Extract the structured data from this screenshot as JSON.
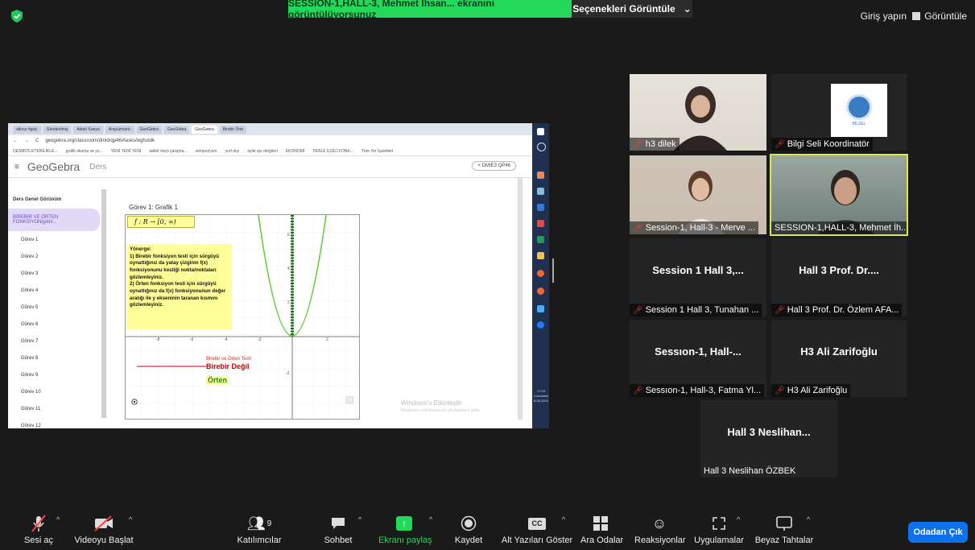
{
  "top": {
    "share_banner": "SESSION-1,HALL-3, Mehmet İhsan... ekranını görüntülüyorsunuz",
    "view_options": "Seçenekleri Görüntüle",
    "sign_in": "Giriş yapın",
    "view": "Görüntüle"
  },
  "shared_screen": {
    "tabs": [
      "altınız #golc",
      "Gönderilmiş",
      "Aktarl Kanya",
      "Arayüzmaric",
      "GeoGebra",
      "GeoGebra",
      "GeoGebra",
      "Birebir Örte"
    ],
    "address": "geogebra.org/classroom/dmid/qp46#tasks/wghutdk",
    "bookmarks": [
      "DESMOS ETKİNLİKLE...",
      "grafik okuma ve yo...",
      "YENİ YENİ YENİ",
      "tablet öncü çalışma...",
      "sempozyum",
      "yurt dışı",
      "aylık ayı dergileri",
      "EKONOMİ",
      "FENLE İLGİLİ FONK...",
      "Tüm Yer İşaretleri"
    ],
    "logo": "GeoGebra",
    "ders": "Ders",
    "share_label": "DMIE3 QP46",
    "sidebar_title": "Ders Genel Görünüm",
    "sidebar_active": "BİREBİR VE ÖRTEN FONKSİYONlgıldır...",
    "sidebar_items": [
      "Görev 1",
      "Görev 2",
      "Görev 3",
      "Görev 4",
      "Görev 5",
      "Görev 6",
      "Görev 7",
      "Görev 8",
      "Görev 9",
      "Görev 10",
      "Görev 11",
      "Görev 12"
    ],
    "task_title": "Görev 1: Grafik 1",
    "formula": "f : R → [0, ∞)",
    "yonerge": "Yönerge:\n1) Birebir fonksiyon testi için sürgüyü oynattığınız da yatay çizginin f(x) fonksiyonunu kestiği nokta/noktaları gözlemleyiniz.\n2) Örten fonksiyon testi için sürgüyü oynattığınız da f(x) fonksiyonunun değer aralığı ile y ekseninin taranan kısmını gözlemleyiniz.",
    "label_small": "Birebir ve Örten Testi",
    "label_red": "Birebir Değil",
    "label_green": "Örten",
    "watermark": "Windows'u Etkinleştir",
    "watermark_sub": "Windows'u etkinleştirmek için Ayarlar'a gidin.",
    "clock": "17:24",
    "day": "Cumartesi",
    "date": "8.06.2024"
  },
  "participants": [
    {
      "name": "h3 dilek",
      "display": ""
    },
    {
      "name": "Bilgi Seli Koordinatör",
      "display": ""
    },
    {
      "name": "Session-1, Hall-3 - Merve ...",
      "display": ""
    },
    {
      "name": "SESSION-1,HALL-3, Mehmet İh...",
      "display": ""
    },
    {
      "name": "Session 1 Hall 3, Tunahan ...",
      "display": "Session 1 Hall 3,..."
    },
    {
      "name": "Hall 3 Prof. Dr. Özlem AFA...",
      "display": "Hall 3 Prof. Dr...."
    },
    {
      "name": "Sessıon-1, Hall-3, Fatma Yl...",
      "display": "Sessıon-1,  Hall-..."
    },
    {
      "name": "H3 Ali Zarifoğlu",
      "display": "H3 Ali Zarifoğlu"
    },
    {
      "name": "Hall 3 Neslihan ÖZBEK",
      "display": "Hall 3  Neslihan..."
    }
  ],
  "logo_text": "BİLSEL",
  "toolbar": {
    "unmute": "Sesi aç",
    "start_video": "Videoyu Başlat",
    "participants": "Katılımcılar",
    "participant_count": "9",
    "chat": "Sohbet",
    "share_screen": "Ekranı paylaş",
    "record": "Kaydet",
    "captions": "Alt Yazıları Göster",
    "breakout": "Ara Odalar",
    "reactions": "Reaksiyonlar",
    "apps": "Uygulamalar",
    "whiteboard": "Beyaz Tahtalar",
    "leave": "Odadan Çık"
  },
  "colors": {
    "share_green": "#23d959",
    "leave_blue": "#0e71eb",
    "highlight": "#d6e84a",
    "mic_off": "#ff4040"
  }
}
